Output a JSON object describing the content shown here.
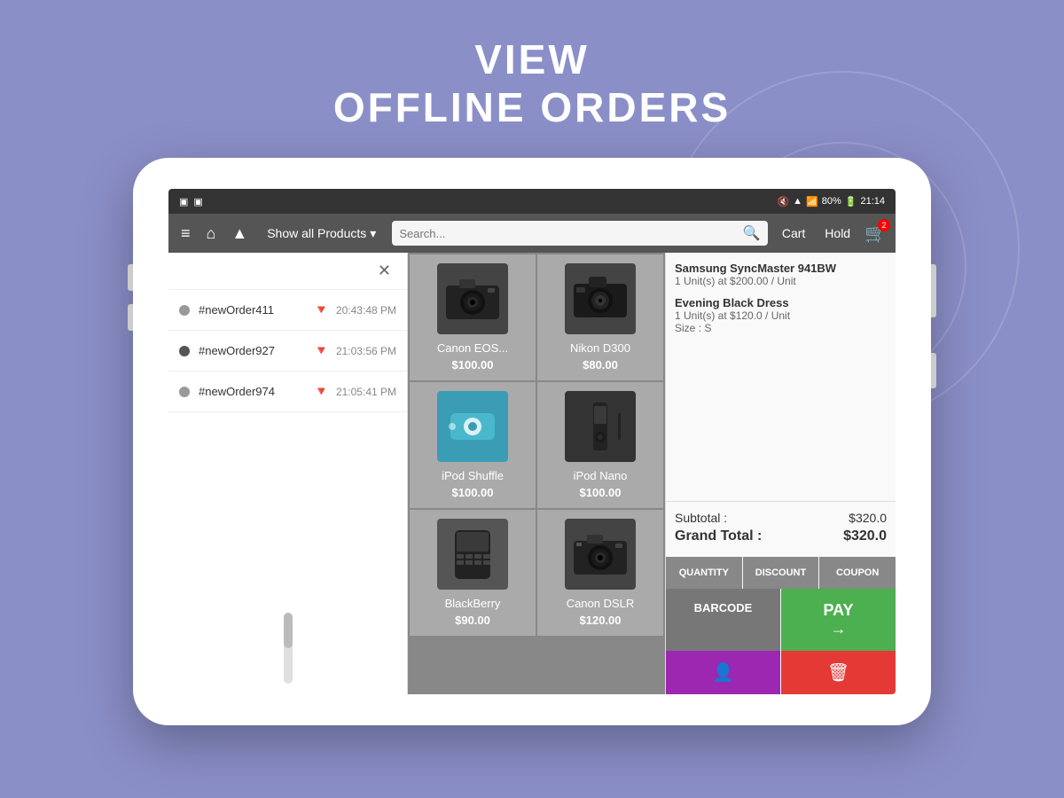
{
  "page": {
    "title_line1": "VIEW",
    "title_line2": "OFFLINE ORDERS"
  },
  "statusbar": {
    "left_icons": [
      "▣",
      "▣"
    ],
    "right_text": "80%",
    "time": "21:14",
    "battery_icon": "🔋",
    "signal_icon": "📶",
    "wifi_icon": "▲",
    "mute_icon": "🔇"
  },
  "toolbar": {
    "menu_icon": "≡",
    "home_icon": "⌂",
    "wifi_icon": "▲",
    "show_products_label": "Show all Products",
    "search_placeholder": "Search...",
    "search_icon": "🔍",
    "cart_label": "Cart",
    "hold_label": "Hold",
    "cart_icon": "🛒",
    "cart_badge": "2"
  },
  "orders": [
    {
      "id": "#newOrder411",
      "time": "20:43:48 PM",
      "active": false
    },
    {
      "id": "#newOrder927",
      "time": "21:03:56 PM",
      "active": true
    },
    {
      "id": "#newOrder974",
      "time": "21:05:41 PM",
      "active": false
    }
  ],
  "products": [
    {
      "name": "Canon EOS...",
      "price": "$100.00",
      "color": "#555"
    },
    {
      "name": "Nikon D300",
      "price": "$80.00",
      "color": "#555"
    },
    {
      "name": "iPod Shuffle",
      "price": "$100.00",
      "color": "#5ab"
    },
    {
      "name": "iPod Nano",
      "price": "$100.00",
      "color": "#333"
    },
    {
      "name": "BlackBerry",
      "price": "$90.00",
      "color": "#555"
    },
    {
      "name": "Canon DSLR",
      "price": "$120.00",
      "color": "#555"
    }
  ],
  "cart": {
    "items": [
      {
        "name": "Samsung SyncMaster 941BW",
        "detail": "1 Unit(s) at $200.00 / Unit"
      },
      {
        "name": "Evening Black Dress",
        "detail": "1 Unit(s) at $120.0 / Unit",
        "size": "Size :  S"
      }
    ],
    "subtotal_label": "Subtotal :",
    "subtotal_value": "$320.0",
    "grand_total_label": "Grand Total :",
    "grand_total_value": "$320.0",
    "btn_quantity": "QUANTITY",
    "btn_discount": "DISCOUNT",
    "btn_coupon": "COUPON",
    "btn_barcode": "BARCODE",
    "btn_pay": "PAY",
    "btn_pay_arrow": "→"
  }
}
